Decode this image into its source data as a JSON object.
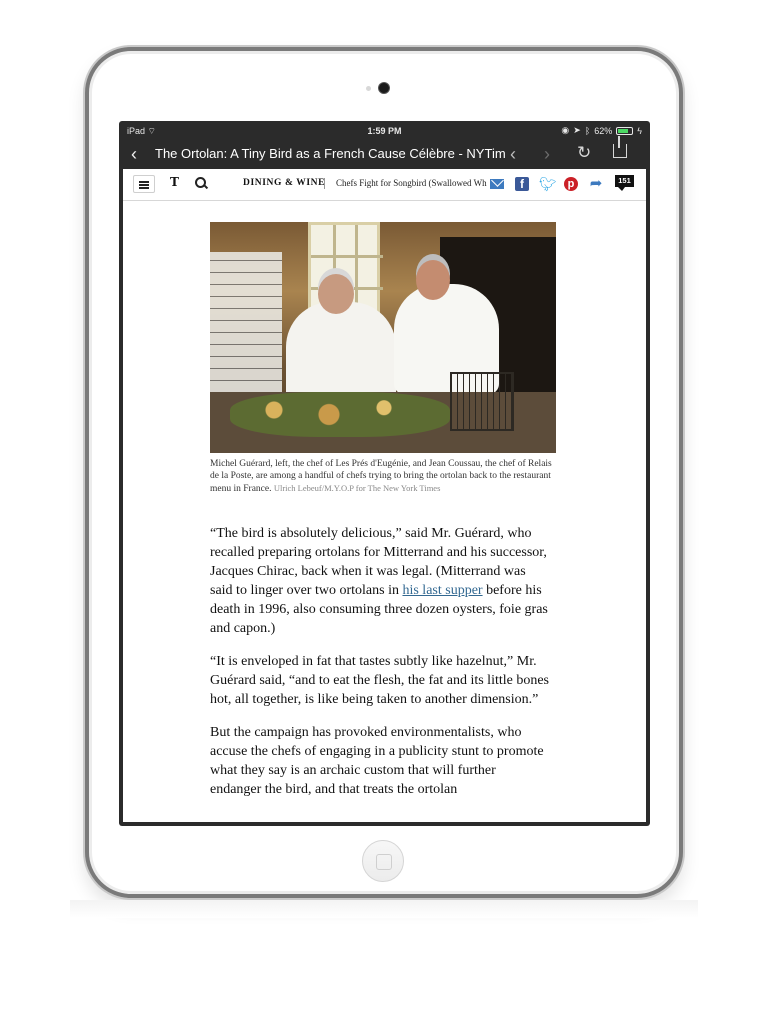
{
  "status_bar": {
    "device": "iPad",
    "time": "1:59 PM",
    "battery": "62%"
  },
  "browser": {
    "title": "The Ortolan: A Tiny Bird as a French Cause Célèbre - NYTim..."
  },
  "toolbar": {
    "logo": "T",
    "section": "DINING & WINE",
    "teaser": "Chefs Fight for Songbird (Swallowed Wh",
    "comment_count": "151"
  },
  "photo": {
    "caption": "Michel Guérard, left, the chef of Les Prés d'Eugénie, and Jean Coussau, the chef of Relais de la Poste, are among a handful of chefs trying to bring the ortolan back to the restaurant menu in France.",
    "credit": "Ulrich Lebeuf/M.Y.O.P for The New York Times"
  },
  "article": {
    "p1_before_link": "“The bird is absolutely delicious,” said Mr. Guérard, who recalled preparing ortolans for Mitterrand and his successor, Jacques Chirac, back when it was legal. (Mitterrand was said to linger over two ortolans in ",
    "p1_link": "his last supper",
    "p1_after_link": " before his death in 1996, also consuming three dozen oysters, foie gras and capon.)",
    "p2": "“It is enveloped in fat that tastes subtly like hazelnut,” Mr. Guérard said, “and to eat the flesh, the fat and its little bones hot, all together, is like being taken to another dimension.”",
    "p3": "But the campaign has provoked environmentalists, who accuse the chefs of engaging in a publicity stunt to promote what they say is an archaic custom that will further endanger the bird, and that treats the ortolan"
  }
}
